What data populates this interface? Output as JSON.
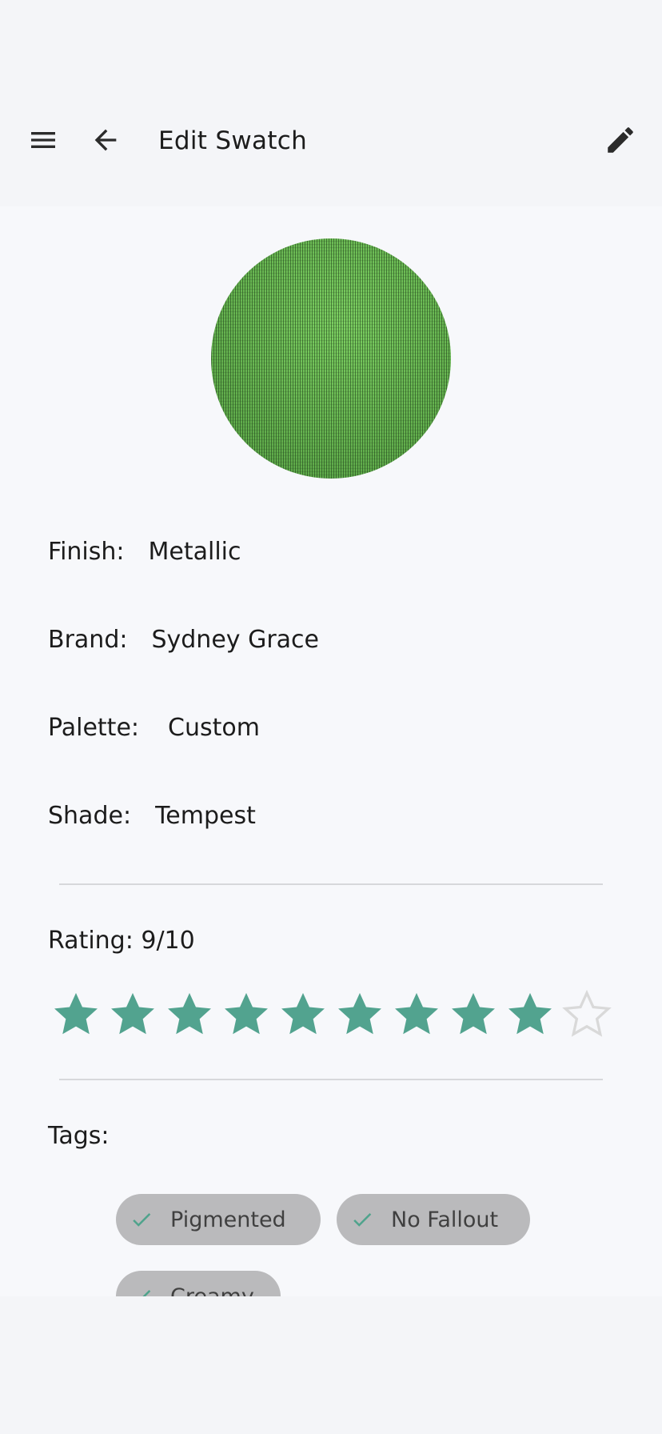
{
  "app_bar": {
    "title": "Edit Swatch",
    "menu_icon": "menu-icon",
    "back_icon": "arrow-back-icon",
    "edit_icon": "pencil-icon"
  },
  "swatch": {
    "color": "#6cc255"
  },
  "details": {
    "finish": {
      "label": "Finish:",
      "value": "Metallic"
    },
    "brand": {
      "label": "Brand:",
      "value": "Sydney Grace"
    },
    "palette": {
      "label": "Palette:",
      "value": "Custom"
    },
    "shade": {
      "label": "Shade:",
      "value": "Tempest"
    }
  },
  "rating": {
    "label": "Rating: 9/10",
    "value": 9,
    "max": 10,
    "filled_color": "#52a38f",
    "empty_color": "#d9d9d9"
  },
  "tags": {
    "label": "Tags:",
    "items": [
      {
        "label": "Pigmented",
        "selected": true
      },
      {
        "label": "No Fallout",
        "selected": true
      },
      {
        "label": "Creamy",
        "selected": true
      }
    ],
    "check_color": "#4fa38c"
  }
}
